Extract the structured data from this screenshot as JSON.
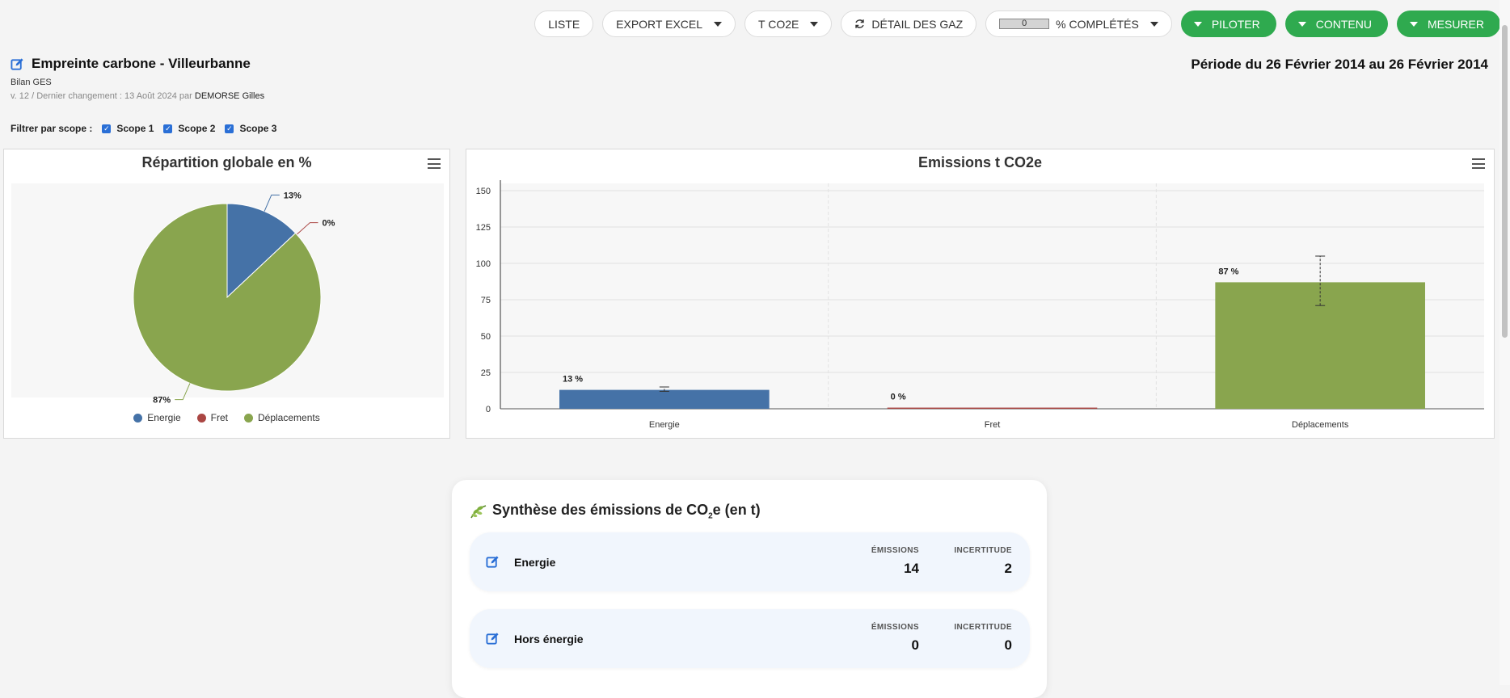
{
  "toolbar": {
    "liste": "LISTE",
    "export_excel": "EXPORT EXCEL",
    "unit": "T CO2E",
    "gas_detail": "DÉTAIL DES GAZ",
    "progress_value": "0",
    "progress_fraction": 0,
    "progress_label": "% COMPLÉTÉS",
    "piloter": "PILOTER",
    "contenu": "CONTENU",
    "mesurer": "MESURER"
  },
  "header": {
    "title": "Empreinte carbone - Villeurbanne",
    "period": "Période du 26 Février 2014 au 26 Février 2014",
    "subtitle": "Bilan GES",
    "meta_prefix": "v. 12 / Dernier changement : 13 Août 2024 par",
    "author": "DEMORSE Gilles"
  },
  "filter": {
    "label": "Filtrer par scope :",
    "scopes": [
      {
        "label": "Scope 1",
        "checked": true
      },
      {
        "label": "Scope 2",
        "checked": true
      },
      {
        "label": "Scope 3",
        "checked": true
      }
    ]
  },
  "colors": {
    "energie": "#4572a7",
    "fret": "#aa4643",
    "deplacements": "#89a54e",
    "accent_green": "#2faa4f",
    "edit_blue": "#2a6fd6"
  },
  "chart_data": [
    {
      "type": "pie",
      "title": "Répartition globale en %",
      "categories": [
        "Energie",
        "Fret",
        "Déplacements"
      ],
      "values": [
        13,
        0,
        87
      ],
      "data_labels": [
        "13%",
        "0%",
        "87%"
      ],
      "legend": "bottom"
    },
    {
      "type": "bar",
      "title": "Emissions t CO2e",
      "categories": [
        "Energie",
        "Fret",
        "Déplacements"
      ],
      "values": [
        13,
        0.8,
        87
      ],
      "error_bars": [
        [
          12,
          15
        ],
        null,
        [
          71,
          105
        ]
      ],
      "data_labels": [
        "13 %",
        "0 %",
        "87 %"
      ],
      "ylim": [
        0,
        155
      ],
      "yticks": [
        "0",
        "25",
        "50",
        "75",
        "100",
        "125",
        "150"
      ],
      "grid": true
    }
  ],
  "synthesis": {
    "title_prefix": "Synthèse des émissions de CO",
    "title_sub": "2",
    "title_suffix": "e (en t)",
    "rows": [
      {
        "label": "Energie",
        "emissions_header": "ÉMISSIONS",
        "emissions": "14",
        "uncertainty_header": "INCERTITUDE",
        "uncertainty": "2"
      },
      {
        "label": "Hors énergie",
        "emissions_header": "ÉMISSIONS",
        "emissions": "0",
        "uncertainty_header": "INCERTITUDE",
        "uncertainty": "0"
      }
    ]
  }
}
